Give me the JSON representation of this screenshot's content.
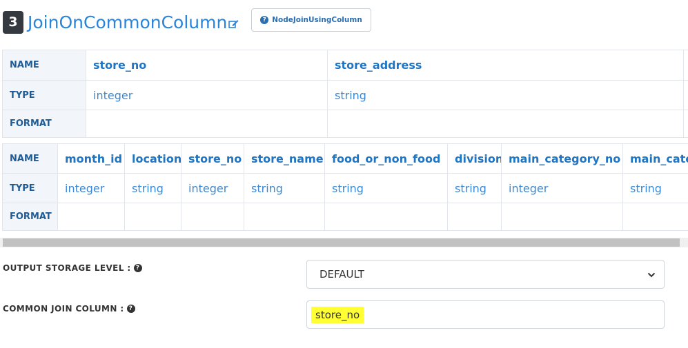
{
  "header": {
    "step_number": "3",
    "title": "JoinOnCommonColumn",
    "doc_button_label": "NodeJoinUsingColumn"
  },
  "schema_tables": [
    {
      "row_labels": [
        "NAME",
        "TYPE",
        "FORMAT"
      ],
      "columns": [
        {
          "name": "store_no",
          "type": "integer",
          "format": ""
        },
        {
          "name": "store_address",
          "type": "string",
          "format": ""
        }
      ]
    },
    {
      "row_labels": [
        "NAME",
        "TYPE",
        "FORMAT"
      ],
      "columns": [
        {
          "name": "month_id",
          "type": "integer",
          "format": ""
        },
        {
          "name": "location",
          "type": "string",
          "format": ""
        },
        {
          "name": "store_no",
          "type": "integer",
          "format": ""
        },
        {
          "name": "store_name",
          "type": "string",
          "format": ""
        },
        {
          "name": "food_or_non_food",
          "type": "string",
          "format": ""
        },
        {
          "name": "division",
          "type": "string",
          "format": ""
        },
        {
          "name": "main_category_no",
          "type": "integer",
          "format": ""
        },
        {
          "name": "main_cate",
          "type": "string",
          "format": ""
        }
      ]
    }
  ],
  "form": {
    "storage_level_label": "OUTPUT STORAGE LEVEL :",
    "storage_level_value": "DEFAULT",
    "join_column_label": "COMMON JOIN COLUMN :",
    "join_column_value": "store_no",
    "help_icon_char": "?"
  },
  "colors": {
    "accent": "#2a84d9",
    "header_cell_bg": "#f2f5f9",
    "highlight": "#ffff33"
  }
}
